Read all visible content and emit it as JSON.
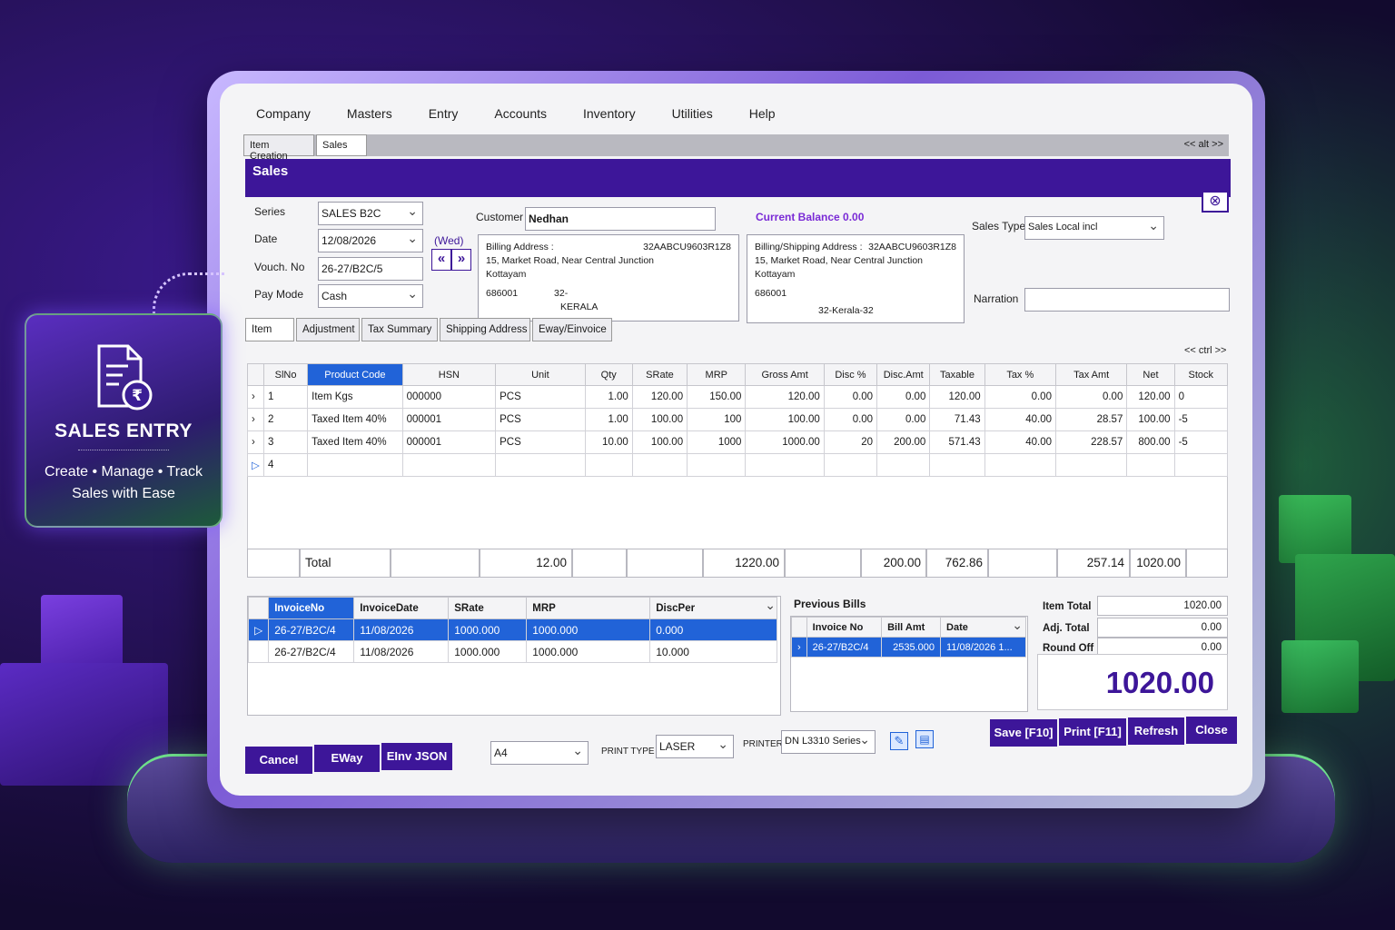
{
  "badge": {
    "title": "SALES ENTRY",
    "subtitle_line1": "Create • Manage • Track",
    "subtitle_line2": "Sales with Ease",
    "icon": "document-rupee-icon"
  },
  "menu": [
    "Company",
    "Masters",
    "Entry",
    "Accounts",
    "Inventory",
    "Utilities",
    "Help"
  ],
  "doc_tabs": [
    "Item Creation",
    "Sales"
  ],
  "alt_nav": "<< alt >>",
  "ctrl_nav": "<< ctrl >>",
  "window_title": "Sales",
  "form": {
    "series_label": "Series",
    "series_value": "SALES B2C",
    "date_label": "Date",
    "date_value": "12/08/2026",
    "day": "(Wed)",
    "vouch_label": "Vouch. No",
    "vouch_value": "26-27/B2C/5",
    "paymode_label": "Pay Mode",
    "paymode_value": "Cash",
    "prev_btn": "«",
    "next_btn": "»",
    "customer_label": "Customer",
    "customer_value": "Nedhan",
    "current_balance": "Current Balance 0.00",
    "sales_type_label": "Sales Type",
    "sales_type_value": "Sales Local incl",
    "narration_label": "Narration",
    "narration_value": ""
  },
  "billing": {
    "heading": "Billing Address :",
    "gstin": "32AABCU9603R1Z8",
    "line1": "15, Market Road, Near Central Junction",
    "line2": "Kottayam",
    "pin": "686001",
    "state_code": "32-",
    "state": "KERALA"
  },
  "shipping": {
    "heading": "Billing/Shipping Address :",
    "gstin": "32AABCU9603R1Z8",
    "line1": "15, Market Road, Near Central Junction",
    "line2": "Kottayam",
    "pin": "686001",
    "state": "32-Kerala-32"
  },
  "subtabs": [
    "Item",
    "Adjustment",
    "Tax Summary",
    "Shipping Address",
    "Eway/Einvoice"
  ],
  "items_table": {
    "columns": [
      "SlNo",
      "Product Code",
      "HSN",
      "Unit",
      "Qty",
      "SRate",
      "MRP",
      "Gross Amt",
      "Disc %",
      "Disc.Amt",
      "Taxable",
      "Tax %",
      "Tax Amt",
      "Net",
      "Stock"
    ],
    "rows": [
      [
        "1",
        "Item Kgs",
        "000000",
        "PCS",
        "1.00",
        "120.00",
        "150.00",
        "120.00",
        "0.00",
        "0.00",
        "120.00",
        "0.00",
        "0.00",
        "120.00",
        "0"
      ],
      [
        "2",
        "Taxed Item 40%",
        "000001",
        "PCS",
        "1.00",
        "100.00",
        "100",
        "100.00",
        "0.00",
        "0.00",
        "71.43",
        "40.00",
        "28.57",
        "100.00",
        "-5"
      ],
      [
        "3",
        "Taxed Item 40%",
        "000001",
        "PCS",
        "10.00",
        "100.00",
        "1000",
        "1000.00",
        "20",
        "200.00",
        "571.43",
        "40.00",
        "228.57",
        "800.00",
        "-5"
      ],
      [
        "4",
        "",
        "",
        "",
        "",
        "",
        "",
        "",
        "",
        "",
        "",
        "",
        "",
        "",
        ""
      ]
    ]
  },
  "totals": {
    "label": "Total",
    "qty": "12.00",
    "gross": "1220.00",
    "disc_amt": "200.00",
    "taxable": "762.86",
    "tax_amt": "257.14",
    "net": "1020.00"
  },
  "history_table": {
    "columns": [
      "InvoiceNo",
      "InvoiceDate",
      "SRate",
      "MRP",
      "DiscPer"
    ],
    "rows": [
      [
        "26-27/B2C/4",
        "11/08/2026",
        "1000.000",
        "1000.000",
        "0.000"
      ],
      [
        "26-27/B2C/4",
        "11/08/2026",
        "1000.000",
        "1000.000",
        "10.000"
      ]
    ]
  },
  "previous_bills": {
    "title": "Previous Bills",
    "columns": [
      "Invoice No",
      "Bill Amt",
      "Date"
    ],
    "rows": [
      [
        "26-27/B2C/4",
        "2535.000",
        "11/08/2026 1..."
      ]
    ]
  },
  "summary": {
    "item_total_label": "Item Total",
    "item_total": "1020.00",
    "adj_total_label": "Adj. Total",
    "adj_total": "0.00",
    "round_off_label": "Round Off",
    "round_off": "0.00",
    "grand_total": "1020.00"
  },
  "footer": {
    "cancel": "Cancel",
    "eway": "EWay",
    "einv": "EInv JSON",
    "paper": "A4",
    "print_type_label": "PRINT TYPE",
    "print_type": "LASER",
    "printer_label": "PRINTER",
    "printer": "DN L3310 Series",
    "save": "Save [F10]",
    "print": "Print [F11]",
    "refresh": "Refresh",
    "close": "Close"
  },
  "colors": {
    "accent": "#3d1699",
    "selection": "#2163d8",
    "success": "#3bbf5b"
  }
}
